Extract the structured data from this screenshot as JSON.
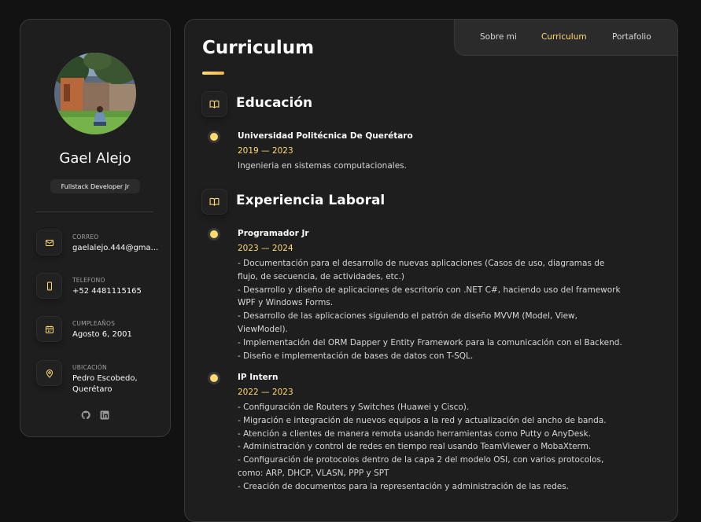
{
  "profile": {
    "name": "Gael Alejo",
    "role": "Fullstack Developer Jr"
  },
  "contacts": [
    {
      "label": "CORREO",
      "value": "gaelalejo.444@gma...",
      "icon": "mail-icon"
    },
    {
      "label": "TELEFONO",
      "value": "+52 4481115165",
      "icon": "phone-icon"
    },
    {
      "label": "CUMPLEAÑOS",
      "value": "Agosto 6, 2001",
      "icon": "calendar-icon"
    },
    {
      "label": "UBICACIÓN",
      "value": "Pedro Escobedo, Querétaro",
      "icon": "location-pin-icon"
    }
  ],
  "socials": [
    "github-icon",
    "linkedin-icon"
  ],
  "nav": {
    "items": [
      "Sobre mi",
      "Curriculum",
      "Portafolio"
    ],
    "active": "Curriculum"
  },
  "page": {
    "title": "Curriculum"
  },
  "sections": [
    {
      "title": "Educación",
      "icon": "book-icon",
      "items": [
        {
          "title": "Universidad Politécnica De Querétaro",
          "date": "2019 — 2023",
          "lines": [
            "Ingenieria en sistemas computacionales."
          ]
        }
      ]
    },
    {
      "title": "Experiencia Laboral",
      "icon": "book-icon",
      "items": [
        {
          "title": "Programador Jr",
          "date": "2023 — 2024",
          "lines": [
            "- Documentación para el desarrollo de nuevas aplicaciones (Casos de uso, diagramas de",
            "flujo, de secuencia, de actividades, etc.)",
            "- Desarrollo y diseño de aplicaciones de escritorio con .NET C#, haciendo uso del framework",
            "WPF y Windows Forms.",
            "- Desarrollo de las aplicaciones siguiendo el patrón de diseño MVVM (Model, View,",
            "ViewModel).",
            "- Implementación del ORM Dapper y Entity Framework para la comunicación con el Backend.",
            "- Diseño e implementación de bases de datos con T-SQL."
          ]
        },
        {
          "title": "IP Intern",
          "date": "2022 — 2023",
          "lines": [
            "- Configuración de Routers y Switches (Huawei y Cisco).",
            "- Migración e integración de nuevos equipos a la red y actualización del ancho de banda.",
            "- Atención a clientes de manera remota usando herramientas como Putty o AnyDesk.",
            "- Administración y control de redes en tiempo real usando TeamViewer o MobaXterm.",
            "- Configuración de protocolos dentro de la capa 2 del modelo OSI, con varios protocolos,",
            "como: ARP, DHCP, VLASN, PPP y SPT",
            "- Creación de documentos para la representación y administración de las redes."
          ]
        }
      ]
    }
  ],
  "colors": {
    "accent": "#ffdb70",
    "panel": "#1e1e1f",
    "background": "#121212"
  }
}
